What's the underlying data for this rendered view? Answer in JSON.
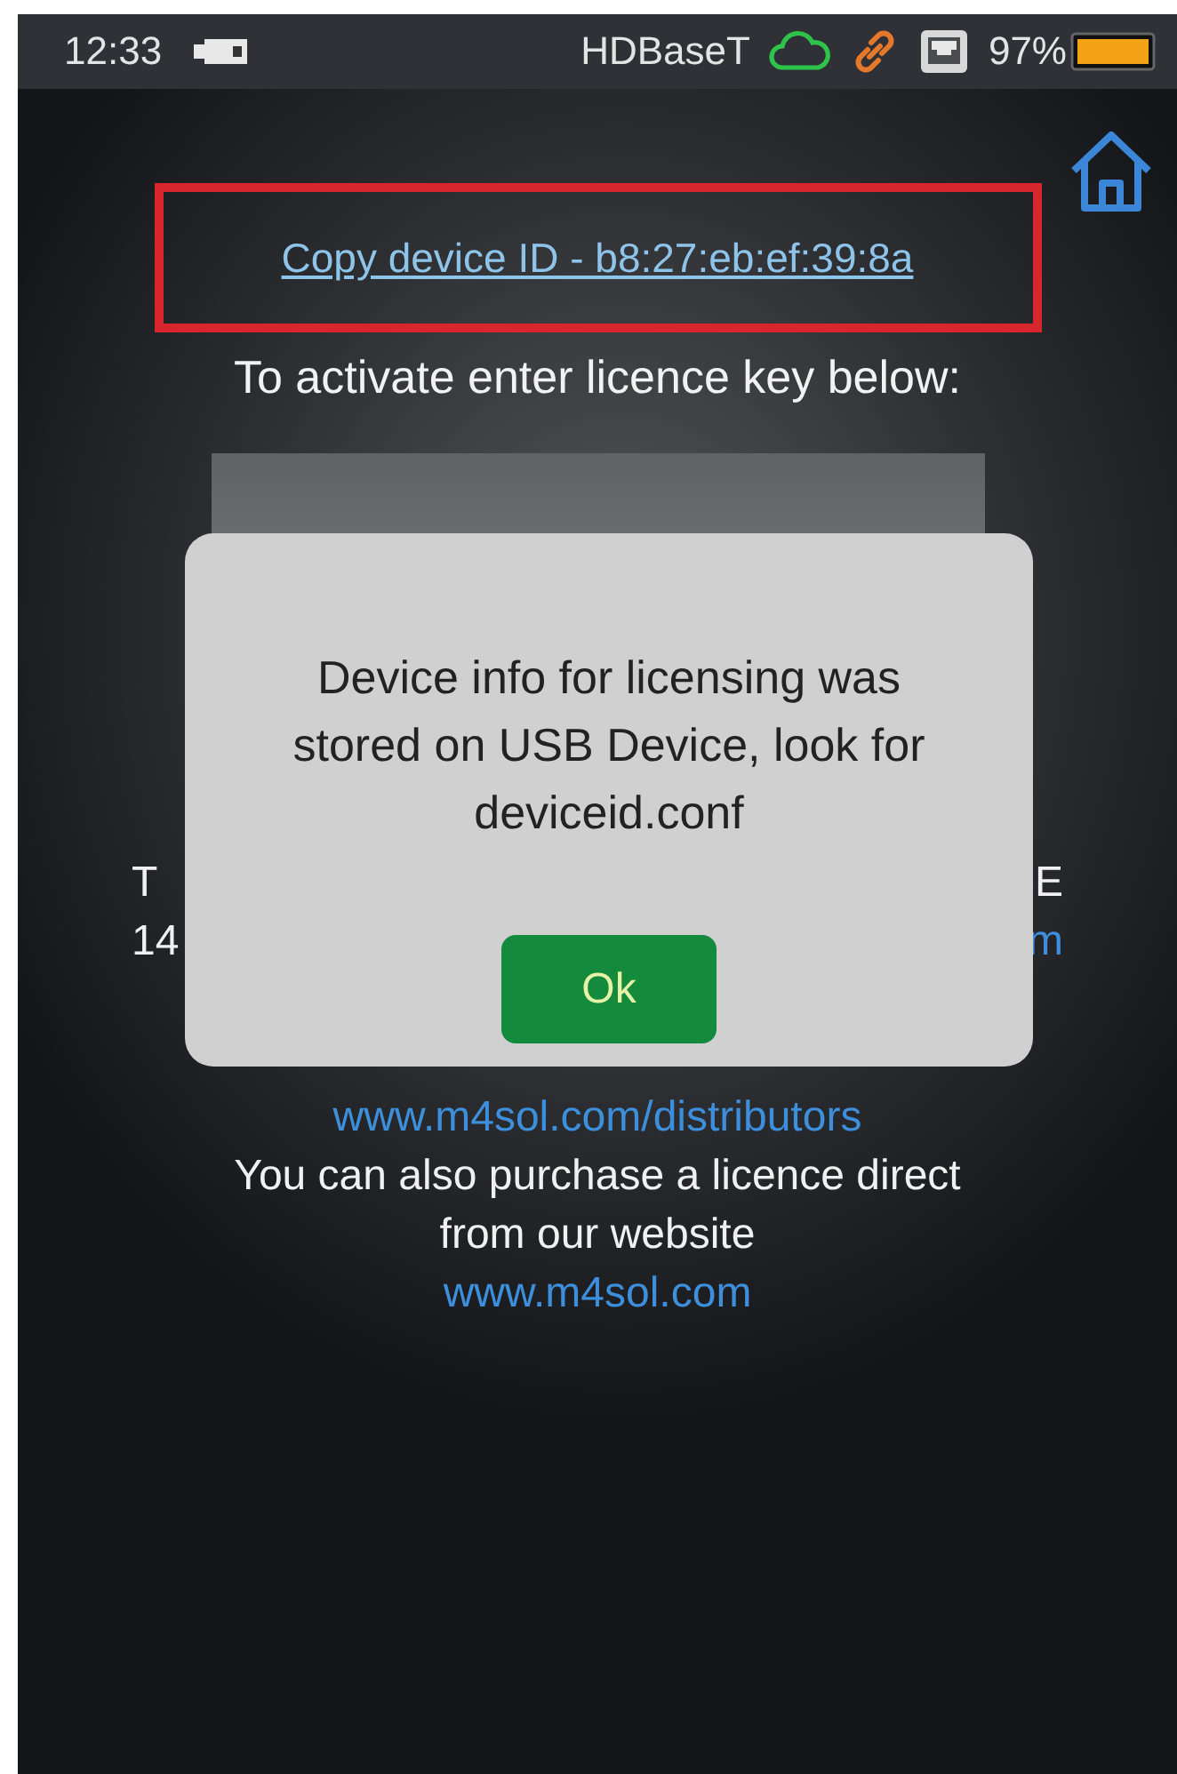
{
  "status_bar": {
    "time": "12:33",
    "connection": "HDBaseT",
    "battery": "97%"
  },
  "device_id_link": "Copy device ID - b8:27:eb:ef:39:8a",
  "heading": "To activate enter licence key below:",
  "partial_rows": [
    {
      "fragments": [
        {
          "text": "T",
          "kind": "text"
        },
        {
          "text": "E",
          "kind": "text"
        }
      ]
    },
    {
      "fragments": [
        {
          "text": "14",
          "kind": "text"
        },
        {
          "text": "m",
          "kind": "link"
        }
      ]
    }
  ],
  "info_lines": [
    {
      "text": "www.m4sol.com/distributors",
      "kind": "link"
    },
    {
      "text": "You can also purchase a licence direct from our website",
      "kind": "text"
    },
    {
      "text": "www.m4sol.com",
      "kind": "link"
    }
  ],
  "dialog": {
    "message": "Device info for licensing was stored on USB Device, look for deviceid.conf",
    "button": "Ok"
  }
}
